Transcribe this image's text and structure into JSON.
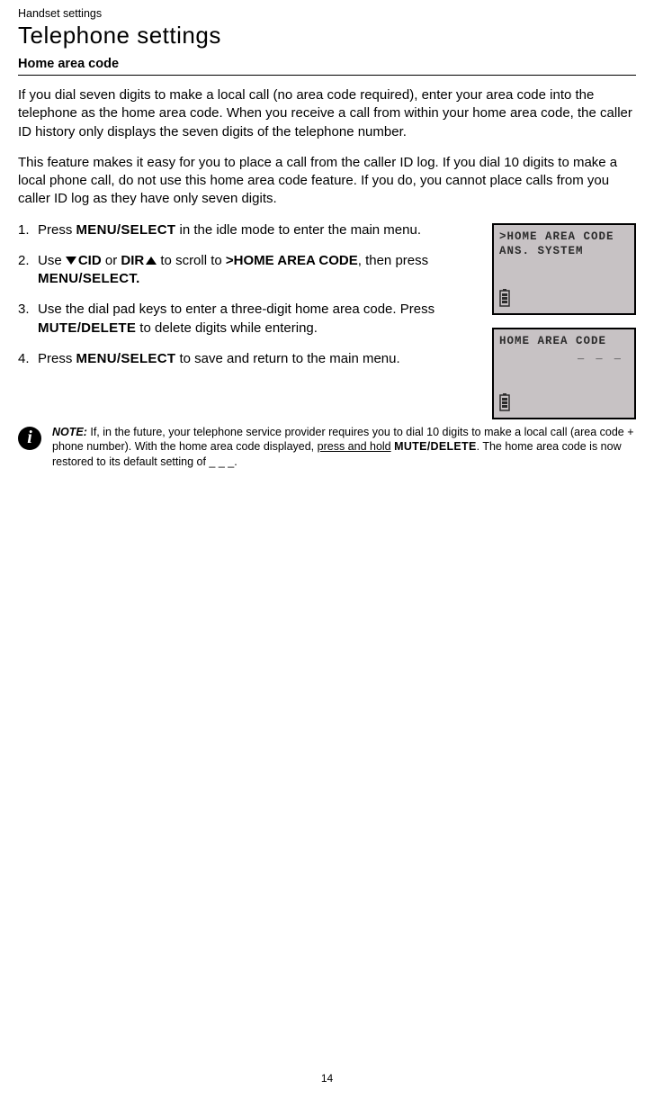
{
  "breadcrumb": "Handset settings",
  "title": "Telephone settings",
  "section_heading": "Home area code",
  "para1": "If you dial seven digits to make a local call (no area code required), enter your area code into the telephone as the home area code. When you receive a call from within your home area code, the caller ID history only displays the seven digits of the telephone number.",
  "para2": "This feature makes it easy for you to place a call from the caller ID log. If you dial 10 digits to make a local phone call, do not use this home area code feature. If you do, you cannot place calls from you caller ID log as they have only seven digits.",
  "steps": {
    "s1a": "Press ",
    "s1b": "MENU/SELECT",
    "s1c": " in the idle mode to enter the main menu.",
    "s2a": "Use ",
    "s2cid": "CID",
    "s2b": " or ",
    "s2dir": "DIR",
    "s2c": " to scroll to ",
    "s2target": ">HOME AREA CODE",
    "s2d": ", then press ",
    "s2e": "MENU/SELECT.",
    "s3a": "Use the dial pad keys to enter a three-digit home area code. Press ",
    "s3b": "MUTE/DELETE",
    "s3c": " to delete digits while entering.",
    "s4a": "Press ",
    "s4b": "MENU/SELECT",
    "s4c": " to save and return to the main menu."
  },
  "lcd1": {
    "line1": ">HOME AREA CODE",
    "line2": " ANS. SYSTEM"
  },
  "lcd2": {
    "line1": "HOME AREA CODE",
    "input": "_ _ _"
  },
  "note": {
    "label": "NOTE:",
    "t1": " If, in the future, your telephone service provider requires you to dial 10 digits to make a local call (area code + phone number). With the home area code displayed, ",
    "underline": "press and hold",
    "t2": " ",
    "key": "MUTE/DELETE",
    "t3": ". The home area code is now restored to its default setting of _ _ _."
  },
  "page_number": "14"
}
